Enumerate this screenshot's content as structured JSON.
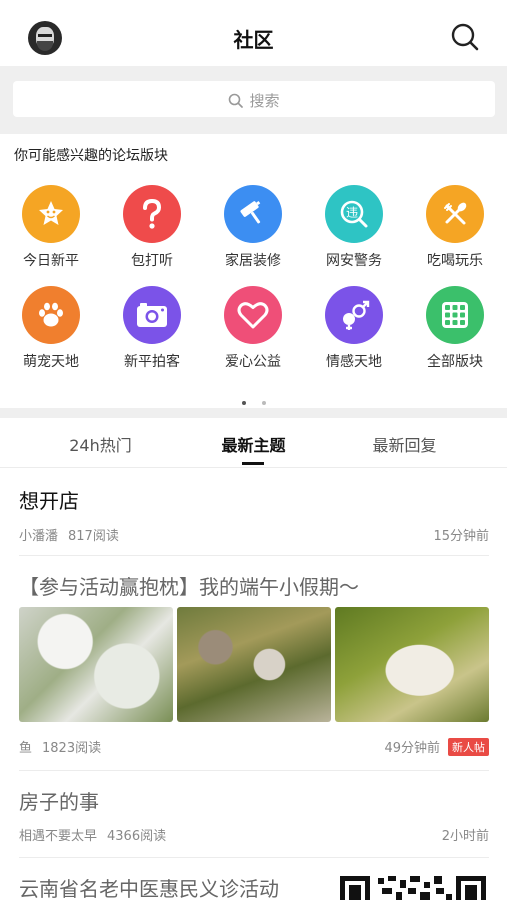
{
  "header": {
    "title": "社区"
  },
  "search": {
    "placeholder": "搜索"
  },
  "forums": {
    "section_title": "你可能感兴趣的论坛版块",
    "items": [
      {
        "label": "今日新平",
        "icon": "star-badge-icon",
        "color": "#f5a524"
      },
      {
        "label": "包打听",
        "icon": "question-mark-icon",
        "color": "#ef4b4b"
      },
      {
        "label": "家居装修",
        "icon": "paint-roller-icon",
        "color": "#3c8ef2"
      },
      {
        "label": "网安警务",
        "icon": "shield-search-icon",
        "color": "#2ec4c4"
      },
      {
        "label": "吃喝玩乐",
        "icon": "fork-knife-icon",
        "color": "#f5a524"
      },
      {
        "label": "萌宠天地",
        "icon": "paw-icon",
        "color": "#f07f2e"
      },
      {
        "label": "新平拍客",
        "icon": "camera-icon",
        "color": "#7b53e8"
      },
      {
        "label": "爱心公益",
        "icon": "heart-icon",
        "color": "#ef4f78"
      },
      {
        "label": "情感天地",
        "icon": "gender-icon",
        "color": "#7b53e8"
      },
      {
        "label": "全部版块",
        "icon": "grid-icon",
        "color": "#3bc06b"
      }
    ]
  },
  "tabs": [
    {
      "label": "24h热门"
    },
    {
      "label": "最新主题"
    },
    {
      "label": "最新回复"
    }
  ],
  "posts": [
    {
      "title": "想开店",
      "author": "小潘潘",
      "views": "817阅读",
      "time": "15分钟前"
    },
    {
      "title": "【参与活动赢抱枕】我的端午小假期～",
      "author": "鱼",
      "views": "1823阅读",
      "time": "49分钟前",
      "badge": "新人帖"
    },
    {
      "title": "房子的事",
      "author": "相遇不要太早",
      "views": "4366阅读",
      "time": "2小时前"
    },
    {
      "title": "云南省名老中医惠民义诊活动"
    }
  ]
}
